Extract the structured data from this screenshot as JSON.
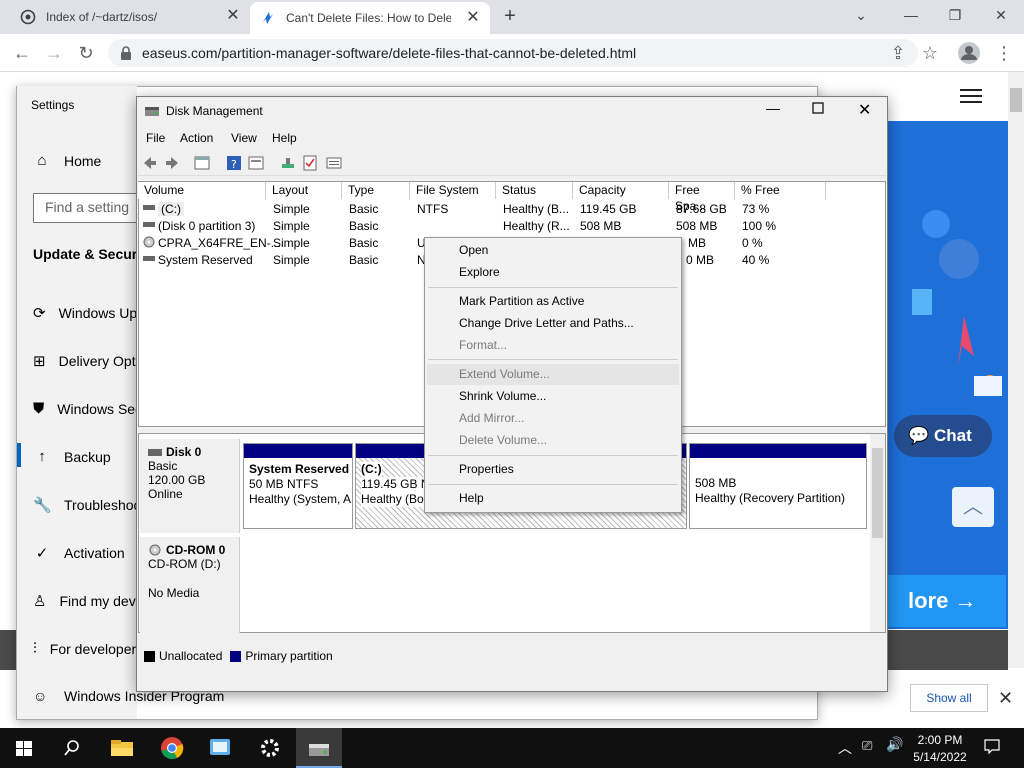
{
  "browser": {
    "tabs": [
      {
        "title": "Index of /~dartz/isos/",
        "active": false
      },
      {
        "title": "Can't Delete Files: How to Delete",
        "active": true
      }
    ],
    "url": "easeus.com/partition-manager-software/delete-files-that-cannot-be-deleted.html"
  },
  "webpage": {
    "chat_label": "Chat",
    "more_label": "lore",
    "show_all_label": "Show all",
    "accent_color": "#1e6fd8"
  },
  "settings": {
    "title": "Settings",
    "home": "Home",
    "search_placeholder": "Find a setting",
    "section": "Update & Security",
    "items": [
      {
        "label": "Windows Update",
        "icon": "refresh-icon"
      },
      {
        "label": "Delivery Optimization",
        "icon": "delivery-icon"
      },
      {
        "label": "Windows Security",
        "icon": "shield-icon"
      },
      {
        "label": "Backup",
        "icon": "backup-arrow-icon"
      },
      {
        "label": "Troubleshoot",
        "icon": "wrench-icon"
      },
      {
        "label": "Activation",
        "icon": "check-circle-icon"
      },
      {
        "label": "Find my device",
        "icon": "person-icon"
      },
      {
        "label": "For developers",
        "icon": "dev-icon"
      }
    ],
    "insider": "Windows Insider Program"
  },
  "disk_management": {
    "title": "Disk Management",
    "menu": [
      "File",
      "Action",
      "View",
      "Help"
    ],
    "columns": [
      "Volume",
      "Layout",
      "Type",
      "File System",
      "Status",
      "Capacity",
      "Free Spa...",
      "% Free"
    ],
    "volumes": [
      {
        "volume": "(C:)",
        "layout": "Simple",
        "type": "Basic",
        "fs": "NTFS",
        "status": "Healthy (B...",
        "capacity": "119.45 GB",
        "free": "87.68 GB",
        "pct": "73 %"
      },
      {
        "volume": "(Disk 0 partition 3)",
        "layout": "Simple",
        "type": "Basic",
        "fs": "",
        "status": "Healthy (R...",
        "capacity": "508 MB",
        "free": "508 MB",
        "pct": "100 %"
      },
      {
        "volume": "CPRA_X64FRE_EN-...",
        "layout": "Simple",
        "type": "Basic",
        "fs": "U",
        "status": "",
        "capacity": "",
        "free": "MB",
        "pct": "0 %"
      },
      {
        "volume": "System Reserved",
        "layout": "Simple",
        "type": "Basic",
        "fs": "N",
        "status": "",
        "capacity": "",
        "free": "0 MB",
        "pct": "40 %"
      }
    ],
    "disk0": {
      "name": "Disk 0",
      "type": "Basic",
      "size": "120.00 GB",
      "state": "Online"
    },
    "partitions": [
      {
        "name": "System Reserved",
        "size": "50 MB NTFS",
        "status": "Healthy (System, A"
      },
      {
        "name": "(C:)",
        "size": "119.45 GB N",
        "status": "Healthy (Bo"
      },
      {
        "name": "",
        "size": "508 MB",
        "status": "Healthy (Recovery Partition)"
      }
    ],
    "cdrom": {
      "name": "CD-ROM 0",
      "drive": "CD-ROM (D:)",
      "media": "No Media"
    },
    "legend": {
      "unallocated": "Unallocated",
      "primary": "Primary partition",
      "primary_color": "#000080"
    }
  },
  "context_menu": {
    "items": [
      {
        "label": "Open",
        "enabled": true
      },
      {
        "label": "Explore",
        "enabled": true
      },
      {
        "label": "Mark Partition as Active",
        "enabled": true
      },
      {
        "label": "Change Drive Letter and Paths...",
        "enabled": true
      },
      {
        "label": "Format...",
        "enabled": false
      },
      {
        "label": "Extend Volume...",
        "enabled": false
      },
      {
        "label": "Shrink Volume...",
        "enabled": true
      },
      {
        "label": "Add Mirror...",
        "enabled": false
      },
      {
        "label": "Delete Volume...",
        "enabled": false
      },
      {
        "label": "Properties",
        "enabled": true
      },
      {
        "label": "Help",
        "enabled": true
      }
    ]
  },
  "taskbar": {
    "time": "2:00 PM",
    "date": "5/14/2022"
  }
}
